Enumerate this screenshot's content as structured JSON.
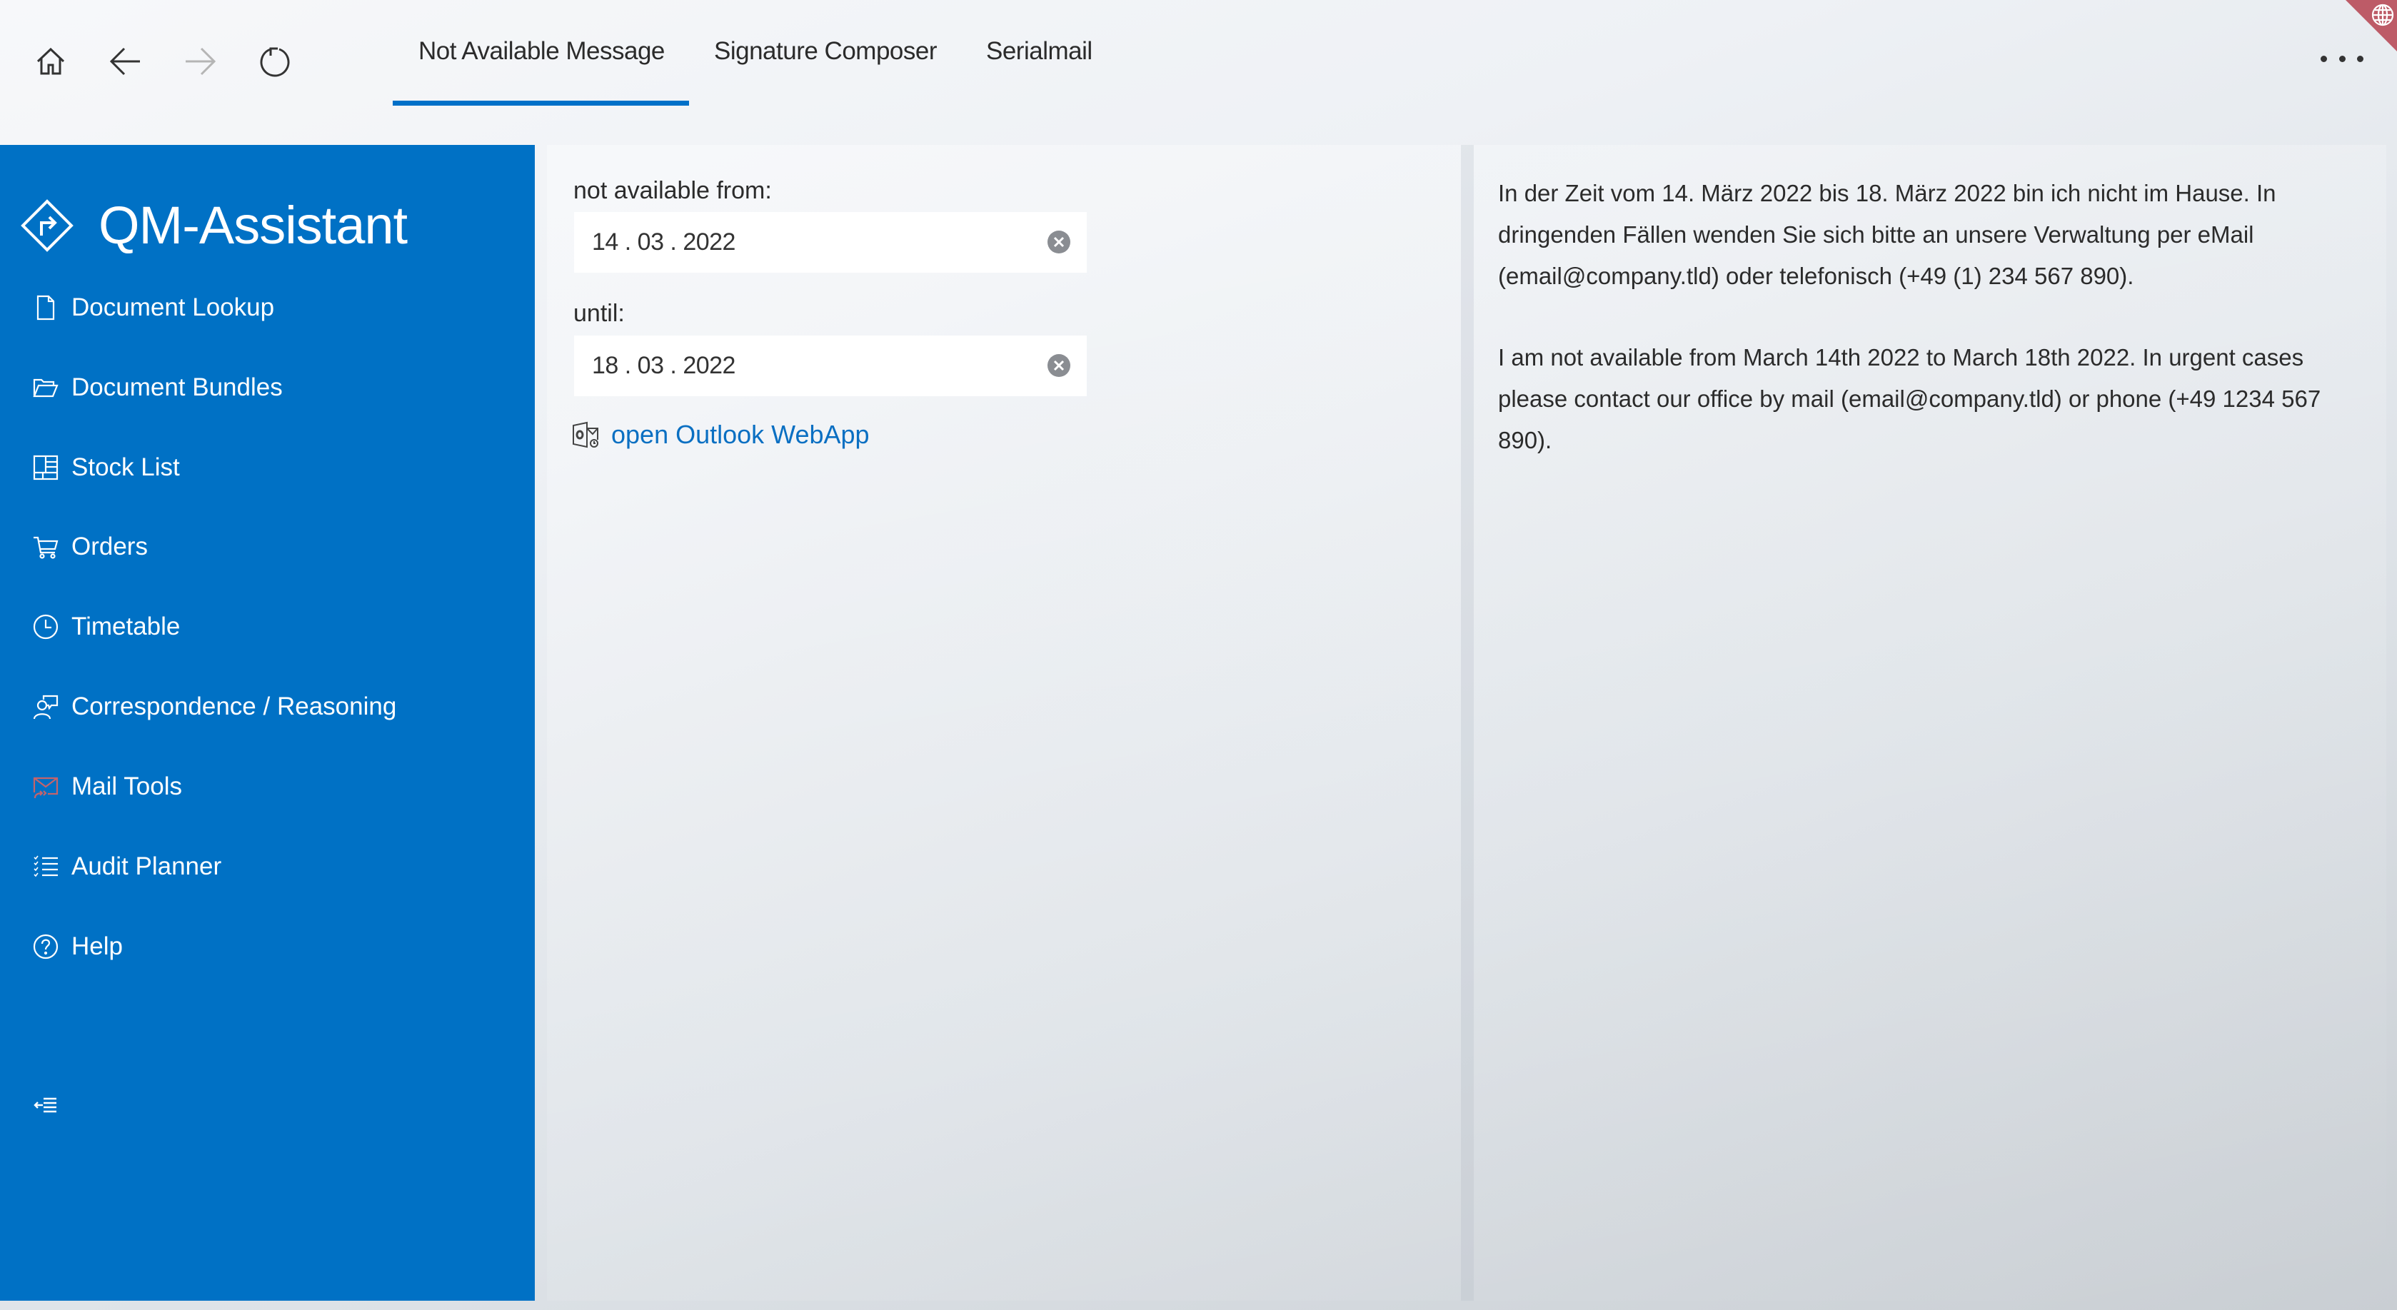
{
  "header": {
    "nav": {
      "home": "home-icon",
      "back": "arrow-left-icon",
      "forward": "arrow-right-icon",
      "refresh": "refresh-icon"
    },
    "tabs": [
      {
        "label": "Not Available Message",
        "active": true
      },
      {
        "label": "Signature Composer",
        "active": false
      },
      {
        "label": "Serialmail",
        "active": false
      }
    ],
    "more_icon": "more-horizontal-icon",
    "corner_badge_icon": "globe-icon"
  },
  "sidebar": {
    "app_title": "QM-Assistant",
    "logo_icon": "directions-diamond-icon",
    "items": [
      {
        "label": "Document Lookup",
        "icon": "document-icon"
      },
      {
        "label": "Document Bundles",
        "icon": "folder-open-icon"
      },
      {
        "label": "Stock List",
        "icon": "grid-icon"
      },
      {
        "label": "Orders",
        "icon": "shopping-cart-icon"
      },
      {
        "label": "Timetable",
        "icon": "clock-icon"
      },
      {
        "label": "Correspondence / Reasoning",
        "icon": "person-feedback-icon"
      },
      {
        "label": "Mail Tools",
        "icon": "mail-forward-icon"
      },
      {
        "label": "Audit Planner",
        "icon": "checklist-icon"
      },
      {
        "label": "Help",
        "icon": "help-icon"
      }
    ],
    "collapse_icon": "collapse-menu-icon"
  },
  "form": {
    "from_label": "not available from:",
    "from_value": "14 . 03 . 2022",
    "until_label": "until:",
    "until_value": "18 . 03 . 2022",
    "outlook_link": "open Outlook WebApp"
  },
  "message": {
    "german": "In der Zeit vom 14. März 2022 bis 18. März 2022 bin ich nicht im Hause. In dringenden Fällen wenden Sie sich bitte an unsere Verwaltung per eMail (email@company.tld) oder telefonisch (+49 (1) 234 567 890).",
    "english": "I am not available from March 14th 2022 to March 18th 2022. In urgent cases please contact our office by mail (email@company.tld) or phone (+49 1234 567 890)."
  },
  "colors": {
    "accent": "#0071c5",
    "link": "#0a6fc2",
    "mail_tools_icon": "#c4636b",
    "badge": "#bd5b67"
  }
}
